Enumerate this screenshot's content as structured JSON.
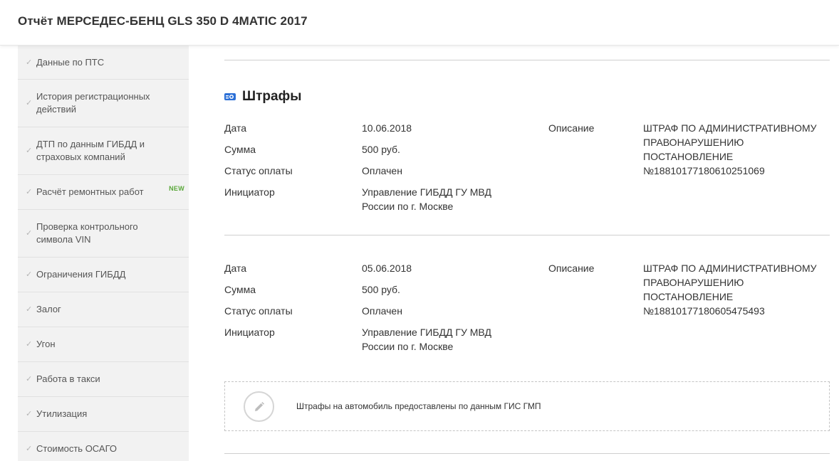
{
  "header": {
    "title": "Отчёт МЕРСЕДЕС-БЕНЦ GLS 350 D 4MATIC 2017"
  },
  "sidebar": {
    "items": [
      {
        "label": "Данные по ПТС"
      },
      {
        "label": "История регистрационных действий"
      },
      {
        "label": "ДТП по данным ГИБДД и страховых компаний"
      },
      {
        "label": "Расчёт ремонтных работ",
        "badge": "NEW"
      },
      {
        "label": "Проверка контрольного символа VIN"
      },
      {
        "label": "Ограничения ГИБДД"
      },
      {
        "label": "Залог"
      },
      {
        "label": "Угон"
      },
      {
        "label": "Работа в такси"
      },
      {
        "label": "Утилизация"
      },
      {
        "label": "Стоимость ОСАГО"
      }
    ]
  },
  "fines": {
    "title": "Штрафы",
    "icon": "fines-icon",
    "accent": "#2b6fd6",
    "records": [
      {
        "date_label": "Дата",
        "date": "10.06.2018",
        "amount_label": "Сумма",
        "amount": "500 руб.",
        "status_label": "Статус оплаты",
        "status": "Оплачен",
        "initiator_label": "Инициатор",
        "initiator": "Управление ГИБДД ГУ МВД России по г. Москве",
        "description_label": "Описание",
        "description": "ШТРАФ ПО АДМИНИСТРАТИВНОМУ ПРАВОНАРУШЕНИЮ ПОСТАНОВЛЕНИЕ №18810177180610251069"
      },
      {
        "date_label": "Дата",
        "date": "05.06.2018",
        "amount_label": "Сумма",
        "amount": "500 руб.",
        "status_label": "Статус оплаты",
        "status": "Оплачен",
        "initiator_label": "Инициатор",
        "initiator": "Управление ГИБДД ГУ МВД России по г. Москве",
        "description_label": "Описание",
        "description": "ШТРАФ ПО АДМИНИСТРАТИВНОМУ ПРАВОНАРУШЕНИЮ ПОСТАНОВЛЕНИЕ №18810177180605475493"
      }
    ],
    "note": {
      "icon": "pencil-icon",
      "text": "Штрафы на автомобиль предоставлены по данным ГИС ГМП"
    }
  }
}
